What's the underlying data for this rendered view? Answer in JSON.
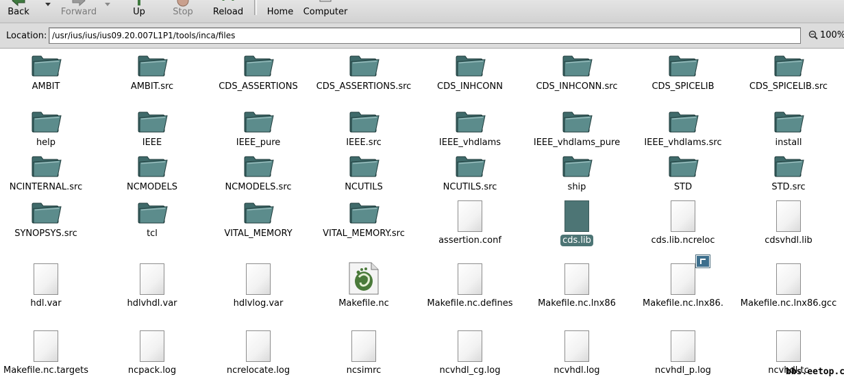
{
  "toolbar": {
    "back": "Back",
    "forward": "Forward",
    "up": "Up",
    "stop": "Stop",
    "reload": "Reload",
    "home": "Home",
    "computer": "Computer"
  },
  "location": {
    "label": "Location:",
    "value": "/usr/ius/ius/ius09.20.007L1P1/tools/inca/files",
    "zoom": "100%"
  },
  "items": [
    {
      "name": "AMBIT",
      "type": "folder"
    },
    {
      "name": "AMBIT.src",
      "type": "folder"
    },
    {
      "name": "CDS_ASSERTIONS",
      "type": "folder"
    },
    {
      "name": "CDS_ASSERTIONS.src",
      "type": "folder"
    },
    {
      "name": "CDS_INHCONN",
      "type": "folder"
    },
    {
      "name": "CDS_INHCONN.src",
      "type": "folder"
    },
    {
      "name": "CDS_SPICELIB",
      "type": "folder"
    },
    {
      "name": "CDS_SPICELIB.src",
      "type": "folder"
    },
    {
      "name": "help",
      "type": "folder"
    },
    {
      "name": "IEEE",
      "type": "folder"
    },
    {
      "name": "IEEE_pure",
      "type": "folder"
    },
    {
      "name": "IEEE.src",
      "type": "folder"
    },
    {
      "name": "IEEE_vhdlams",
      "type": "folder"
    },
    {
      "name": "IEEE_vhdlams_pure",
      "type": "folder"
    },
    {
      "name": "IEEE_vhdlams.src",
      "type": "folder"
    },
    {
      "name": "install",
      "type": "folder"
    },
    {
      "name": "NCINTERNAL.src",
      "type": "folder"
    },
    {
      "name": "NCMODELS",
      "type": "folder"
    },
    {
      "name": "NCMODELS.src",
      "type": "folder"
    },
    {
      "name": "NCUTILS",
      "type": "folder"
    },
    {
      "name": "NCUTILS.src",
      "type": "folder"
    },
    {
      "name": "ship",
      "type": "folder"
    },
    {
      "name": "STD",
      "type": "folder"
    },
    {
      "name": "STD.src",
      "type": "folder"
    },
    {
      "name": "SYNOPSYS.src",
      "type": "folder"
    },
    {
      "name": "tcl",
      "type": "folder"
    },
    {
      "name": "VITAL_MEMORY",
      "type": "folder"
    },
    {
      "name": "VITAL_MEMORY.src",
      "type": "folder"
    },
    {
      "name": "assertion.conf",
      "type": "file"
    },
    {
      "name": "cds.lib",
      "type": "file-selected"
    },
    {
      "name": "cds.lib.ncreloc",
      "type": "file"
    },
    {
      "name": "cdsvhdl.lib",
      "type": "file"
    },
    {
      "name": "hdl.var",
      "type": "file"
    },
    {
      "name": "hdlvhdl.var",
      "type": "file"
    },
    {
      "name": "hdlvlog.var",
      "type": "file"
    },
    {
      "name": "Makefile.nc",
      "type": "makefile"
    },
    {
      "name": "Makefile.nc.defines",
      "type": "file"
    },
    {
      "name": "Makefile.nc.lnx86",
      "type": "file"
    },
    {
      "name": "Makefile.nc.lnx86.",
      "type": "file-link"
    },
    {
      "name": "Makefile.nc.lnx86.gcc",
      "type": "file"
    },
    {
      "name": "Makefile.nc.targets",
      "type": "file"
    },
    {
      "name": "ncpack.log",
      "type": "file"
    },
    {
      "name": "ncrelocate.log",
      "type": "file"
    },
    {
      "name": "ncsimrc",
      "type": "file"
    },
    {
      "name": "ncvhdl_cg.log",
      "type": "file"
    },
    {
      "name": "ncvhdl.log",
      "type": "file"
    },
    {
      "name": "ncvhdl_p.log",
      "type": "file"
    },
    {
      "name": "ncvhdl.tc",
      "type": "file"
    }
  ],
  "watermark": "bbs.eetop.cn",
  "colors": {
    "folder": "#4f7c7c",
    "selection": "#4d7575"
  }
}
